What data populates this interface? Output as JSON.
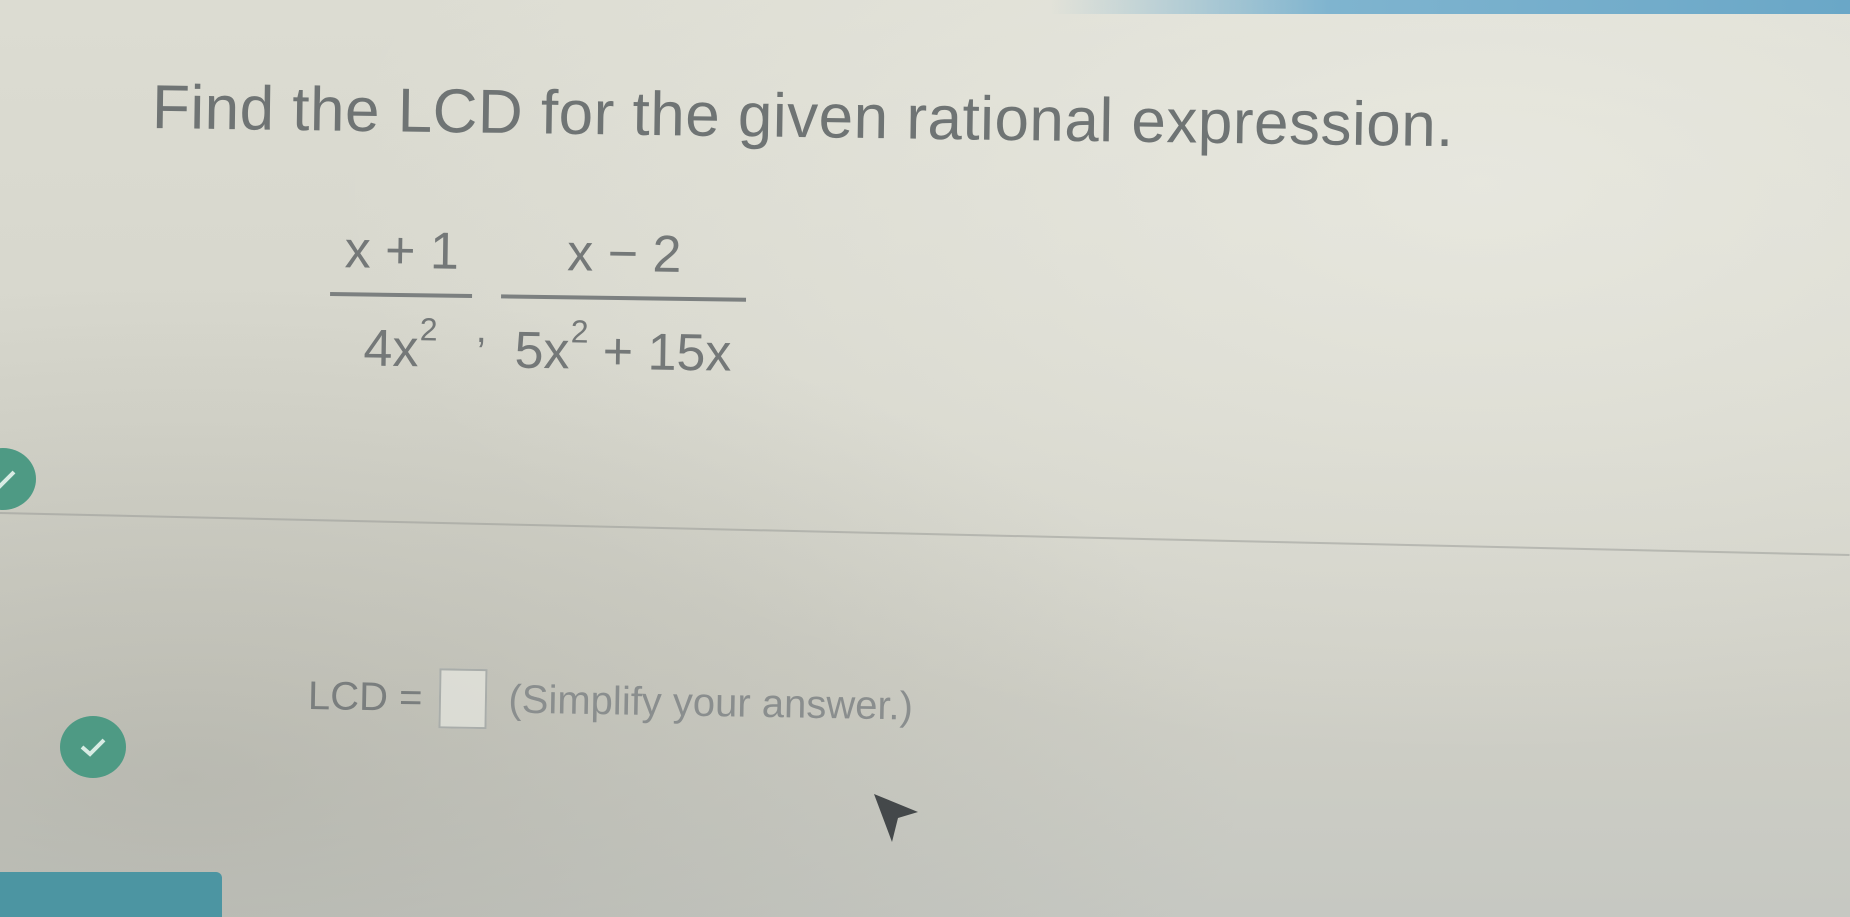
{
  "question": {
    "title": "Find the LCD for the given rational expression."
  },
  "expression": {
    "fraction1": {
      "numerator": "x + 1",
      "denominator_base": "4x",
      "denominator_exp": "2"
    },
    "separator": ",",
    "fraction2": {
      "numerator": "x − 2",
      "denominator_base": "5x",
      "denominator_exp": "2",
      "denominator_rest": " + 15x"
    }
  },
  "answer": {
    "label": "LCD =",
    "value": "",
    "hint": "(Simplify your answer.)"
  },
  "icons": {
    "check": "check-icon",
    "cursor": "mouse-pointer-icon"
  },
  "colors": {
    "accent_green": "#4e9a84",
    "accent_blue": "#6aa7c7",
    "text_gray": "#6f7474"
  }
}
